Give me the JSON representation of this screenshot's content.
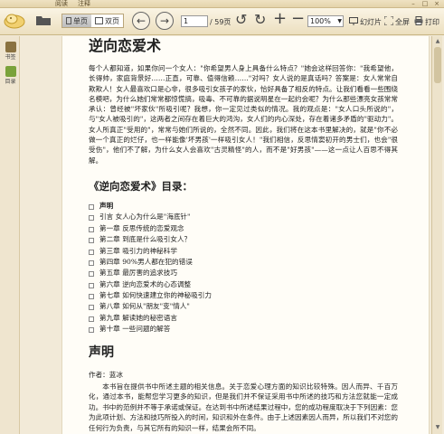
{
  "menubar": {
    "items": [
      "阅读",
      "注释"
    ]
  },
  "toolbar": {
    "view_single": "单页",
    "view_double": "双页",
    "page_current": "1",
    "page_total": "/ 59页",
    "zoom": "100%",
    "slideshow": "幻灯片",
    "fullscreen": "全屏",
    "print": "打印"
  },
  "sidebar": {
    "items": [
      {
        "label": "书签",
        "icon": "bookmark-icon"
      },
      {
        "label": "目录",
        "icon": "toc-icon"
      }
    ]
  },
  "document": {
    "title": "逆向恋爱术",
    "intro": "每个人都知道，如果你问一个女人：\"你希望男人身上具备什么特点？\"她会这样回答你：\"我希望他，长得帅，家庭背景好……正直，可靠、值得信赖……\"对吗？女人说的是真话吗？答案是：女人常常自欺欺人！女人最喜欢口是心非，很多吸引女孩子的家伙，恰好具备了相反的特点。让我们看看一些围绕名模吧，为什么她们常常都惊慌搞，吸毒、不可靠的据说明星在一起约会呢？为什么那些漂亮女孩常常承认：曾经被\"坏家伙\"所吸引呢？我想，你一定见过类似的情况。我的观点是：\"女人口头所说的\"，与\"女人被吸引的\"，这两者之间存在着巨大的鸿沟，女人们的内心深处，存在着诸多矛盾的\"驱动力\"。女人所真正\"受用的\"，常常与她们所说的，全然不同。因此，我们将在这本书里解决的，就是\"你不必做一个真正的烂仔，也一样能像'坏男孩'一样吸引女人！\"我们相信，反思情窦初开的男士们，也会\"很受伤\"，他们不了解，为什么女人会喜欢\"古灵精怪\"的人，而不是\"好男孩\"——这一点让人百思不得其解。",
    "toc_title": "《逆向恋爱术》目录：",
    "toc": [
      "声明",
      "引言 女人心为什么是\"海底针\"",
      "第一章 反思传统的恋爱观念",
      "第二章 到底是什么吸引女人？",
      "第三章 吸引力的神秘科学",
      "第四章 90%男人都在犯的错误",
      "第五章 最厉害的追求技巧",
      "第六章 逆向恋爱术的心态调整",
      "第七章 如何快速建立你的神秘吸引力",
      "第八章 如何从\"朋友\"变\"情人\"",
      "第九章 解读她的秘密语言",
      "第十章 一些问题的解答"
    ],
    "section_title": "声明",
    "author": "作者：蓝冰",
    "statement": "本书旨在提供书中所述主题的相关信息。关于恋爱心理方面的知识比较特殊。因人而异、千百万化，通过本书，能帮您学习更多的知识，但是我们并不保证采用书中所述的技巧和方法您就能一定成功。书中的范例并不等于承诺或保证。在达到书中所述结果过程中，您的成功程度取决于下列因素：您为此项计划、方法和技巧所投入的时间，知识和外在条件。由于上述因素因人而异，所以我们不对您的任何行为负责，与其它所有的知识一样，结果会所不同。"
  }
}
